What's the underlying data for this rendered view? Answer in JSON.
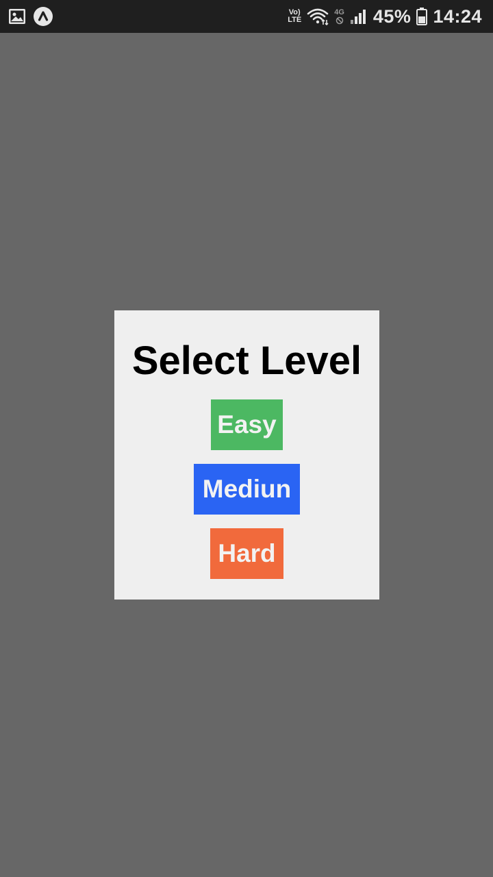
{
  "status_bar": {
    "left_icons": [
      "image-icon",
      "app-a-icon"
    ],
    "volte_top": "Vo)",
    "volte_bottom": "LTE",
    "network_type": "4G",
    "battery_percent": "45%",
    "time": "14:24"
  },
  "dialog": {
    "title": "Select Level",
    "buttons": [
      {
        "label": "Easy",
        "color": "#4cb862"
      },
      {
        "label": "Mediun",
        "color": "#2a64f3"
      },
      {
        "label": "Hard",
        "color": "#f16a3c"
      }
    ]
  },
  "colors": {
    "backdrop": "#676767",
    "dialog_bg": "#efefef",
    "status_bar_bg": "#1f1f1f"
  }
}
